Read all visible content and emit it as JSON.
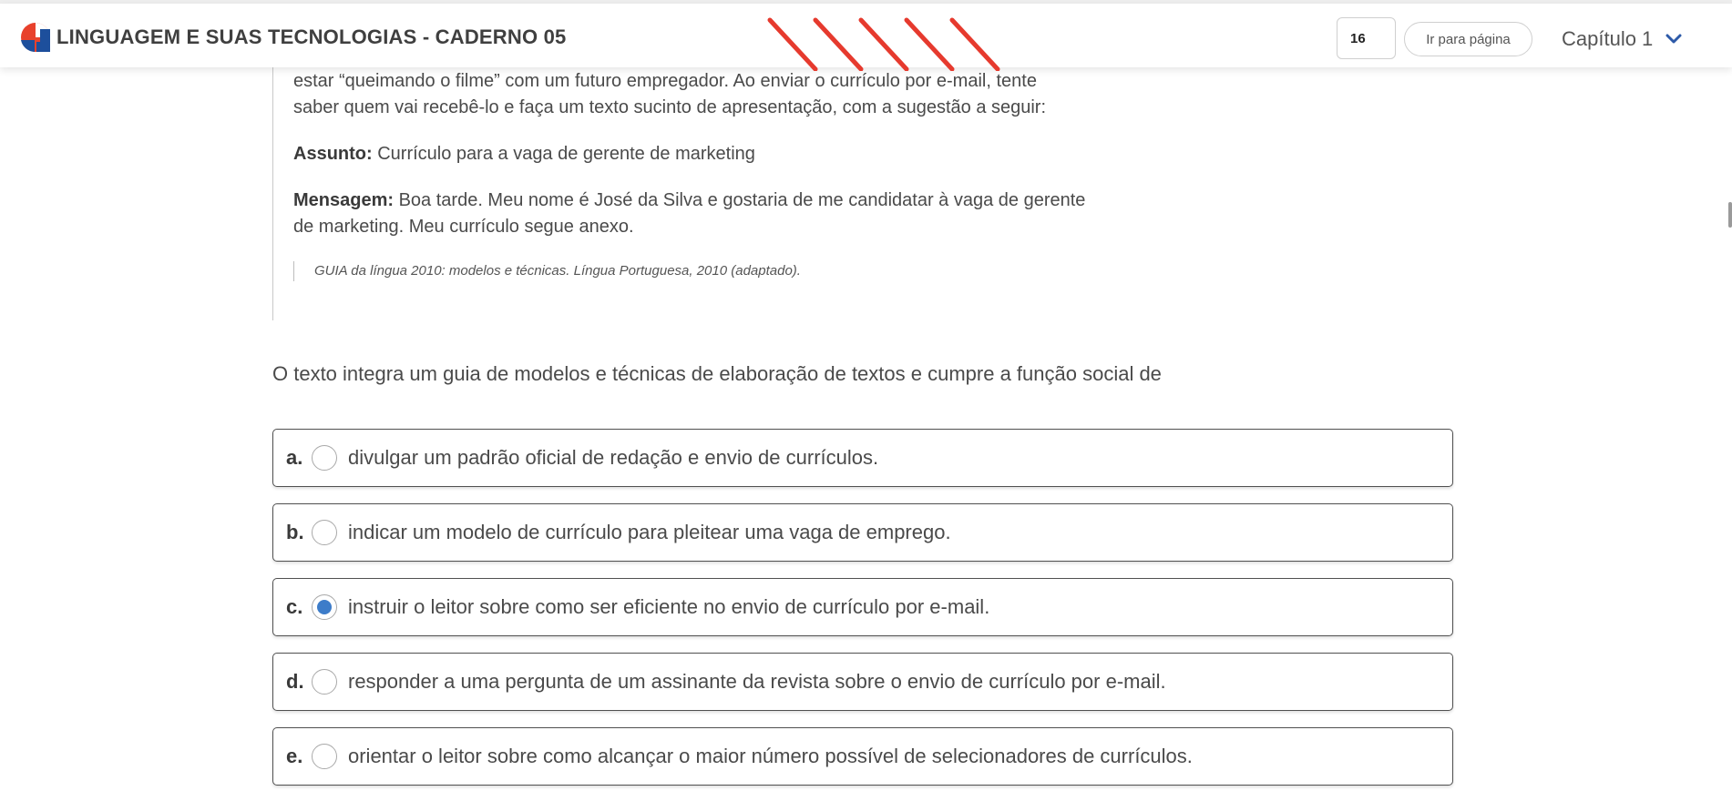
{
  "header": {
    "book_title": "LINGUAGEM E SUAS TECNOLOGIAS - CADERNO 05",
    "page_number": "16",
    "goto_label": "Ir para página",
    "chapter_label": "Capítulo 1",
    "colors": {
      "logo_red": "#e8412c",
      "logo_blue": "#1d4f9c",
      "stripes": "#e63a2e",
      "chevron": "#2d5aa8"
    }
  },
  "article": {
    "lines_top": [
      "estar “queimando o filme” com um futuro empregador. Ao enviar o currículo por e-mail, tente",
      "saber quem vai recebê-lo e faça um texto sucinto de apresentação, com a sugestão a seguir:"
    ],
    "subject_label": "Assunto:",
    "subject_text": "Currículo para a vaga de gerente de marketing",
    "message_label": "Mensagem:",
    "message_line1": "Boa tarde. Meu nome é José da Silva e gostaria de me candidatar à vaga de gerente",
    "message_line2": "de marketing. Meu currículo segue anexo.",
    "source": "GUIA da língua 2010: modelos e técnicas. Língua Portuguesa, 2010 (adaptado)."
  },
  "question": {
    "prompt": "O texto integra um guia de modelos e técnicas de elaboração de textos e cumpre a função social de",
    "options": [
      {
        "letter": "a.",
        "text": "divulgar um padrão oficial de redação e envio de currículos.",
        "selected": false
      },
      {
        "letter": "b.",
        "text": "indicar um modelo de currículo para pleitear uma vaga de emprego.",
        "selected": false
      },
      {
        "letter": "c.",
        "text": "instruir o leitor sobre como ser eficiente no envio de currículo por e-mail.",
        "selected": true
      },
      {
        "letter": "d.",
        "text": "responder a uma pergunta de um assinante da revista sobre o envio de currículo por e-mail.",
        "selected": false
      },
      {
        "letter": "e.",
        "text": "orientar o leitor sobre como alcançar o maior número possível de selecionadores de currículos.",
        "selected": false
      }
    ],
    "selected_color": "#3d7cc9"
  }
}
